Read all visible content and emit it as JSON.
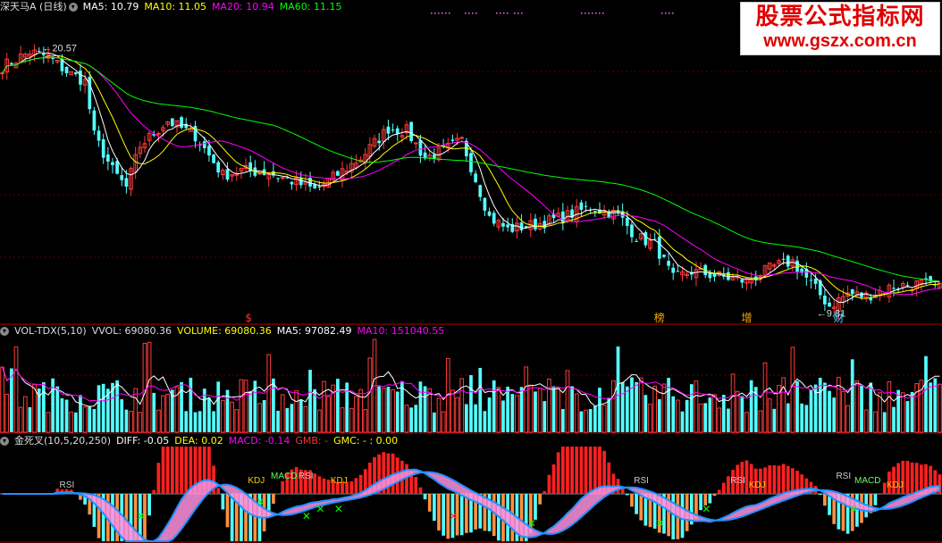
{
  "colors": {
    "up": "#ff3b3b",
    "down": "#54ffff",
    "ma5": "#ffffff",
    "ma10": "#ffff00",
    "ma20": "#ff00ff",
    "ma60": "#00ff00",
    "axis_line": "#b00000",
    "grid": "#5a0000",
    "macd_pos": "#ff2020",
    "macd_neg": "#ff9040",
    "band_blue": "#2090ff",
    "band_pink": "#ff90e0",
    "cross_x": "#00ff00",
    "cross_x_red": "#ff3030"
  },
  "main_header": {
    "title": "深天马A (日线)",
    "ma5": "MA5: 10.79",
    "ma10": "MA10: 11.05",
    "ma20": "MA20: 10.94",
    "ma60": "MA60: 11.15"
  },
  "vol_header": {
    "title": "VOL-TDX(5,10)",
    "vvol": "VVOL: 69080.36",
    "volume": "VOLUME: 69080.36",
    "ma5": "MA5: 97082.49",
    "ma10": "MA10: 151040.55"
  },
  "macd_header": {
    "title": "金死叉(10,5,20,250)",
    "diff": "DIFF: -0.05",
    "dea": "DEA: 0.02",
    "macd": "MACD: -0.14",
    "gmb": "GMB: -",
    "gmc": "GMC: -  : 0.00"
  },
  "watermark": {
    "line1": "股票公式指标网",
    "line2": "www.gszx.com.cn"
  },
  "chart_data": [
    {
      "type": "candlestick",
      "title": "深天马A (日线)",
      "annotations": [
        {
          "text": "20.57",
          "kind": "high",
          "value": 20.57
        },
        {
          "text": "9.81",
          "kind": "low",
          "value": 9.81
        }
      ],
      "event_markers": [
        "$",
        "榜",
        "增",
        "财"
      ],
      "x_count": 205,
      "ylim": [
        9.4,
        22.0
      ],
      "close_anchors": [
        [
          0,
          19.8
        ],
        [
          6,
          20.4
        ],
        [
          10,
          20.2
        ],
        [
          14,
          19.6
        ],
        [
          18,
          19.2
        ],
        [
          20,
          17.0
        ],
        [
          24,
          15.6
        ],
        [
          27,
          14.9
        ],
        [
          30,
          16.6
        ],
        [
          36,
          17.6
        ],
        [
          42,
          17.0
        ],
        [
          48,
          15.4
        ],
        [
          52,
          15.6
        ],
        [
          58,
          15.5
        ],
        [
          64,
          15.1
        ],
        [
          68,
          14.8
        ],
        [
          72,
          15.3
        ],
        [
          78,
          16.1
        ],
        [
          84,
          17.3
        ],
        [
          88,
          17.2
        ],
        [
          92,
          16.1
        ],
        [
          96,
          16.4
        ],
        [
          100,
          16.8
        ],
        [
          106,
          13.7
        ],
        [
          110,
          13.2
        ],
        [
          116,
          13.4
        ],
        [
          122,
          13.7
        ],
        [
          128,
          14.1
        ],
        [
          134,
          13.8
        ],
        [
          138,
          12.9
        ],
        [
          142,
          12.6
        ],
        [
          146,
          11.2
        ],
        [
          150,
          11.5
        ],
        [
          156,
          11.3
        ],
        [
          162,
          11.1
        ],
        [
          168,
          11.7
        ],
        [
          172,
          11.9
        ],
        [
          176,
          11.0
        ],
        [
          180,
          10.1
        ],
        [
          184,
          10.6
        ],
        [
          188,
          10.5
        ],
        [
          194,
          10.9
        ],
        [
          200,
          11.0
        ],
        [
          204,
          10.8
        ]
      ],
      "series": [
        {
          "name": "MA5",
          "value": 10.79
        },
        {
          "name": "MA10",
          "value": 11.05
        },
        {
          "name": "MA20",
          "value": 10.94
        },
        {
          "name": "MA60",
          "value": 11.15
        }
      ]
    },
    {
      "type": "bar",
      "title": "VOL-TDX(5,10)",
      "x_count": 205,
      "ylim": [
        0,
        240000
      ],
      "series": [
        {
          "name": "VOLUME",
          "value": 69080.36
        },
        {
          "name": "MA5",
          "value": 97082.49
        },
        {
          "name": "MA10",
          "value": 151040.55
        }
      ]
    },
    {
      "type": "bar",
      "title": "金死叉(10,5,20,250)",
      "x_count": 205,
      "ylim": [
        -0.9,
        0.9
      ],
      "labels": [
        {
          "text": "RSI",
          "i": 14
        },
        {
          "text": "KDJ",
          "i": 55
        },
        {
          "text": "MACD",
          "i": 60
        },
        {
          "text": "RSI",
          "i": 66
        },
        {
          "text": "KDJ",
          "i": 73
        },
        {
          "text": "RSI",
          "i": 139
        },
        {
          "text": "RSI",
          "i": 160
        },
        {
          "text": "KDJ",
          "i": 164
        },
        {
          "text": "RSI",
          "i": 183
        },
        {
          "text": "MACD",
          "i": 187
        },
        {
          "text": "KDJ",
          "i": 194
        }
      ],
      "crosses": [
        {
          "i": 30,
          "color": "green"
        },
        {
          "i": 56,
          "color": "green"
        },
        {
          "i": 66,
          "color": "green"
        },
        {
          "i": 69,
          "color": "green"
        },
        {
          "i": 73,
          "color": "green"
        },
        {
          "i": 98,
          "color": "red"
        },
        {
          "i": 115,
          "color": "green"
        },
        {
          "i": 143,
          "color": "green"
        },
        {
          "i": 153,
          "color": "green"
        },
        {
          "i": 185,
          "color": "green"
        }
      ],
      "series": [
        {
          "name": "DIFF",
          "value": -0.05
        },
        {
          "name": "DEA",
          "value": 0.02
        },
        {
          "name": "MACD",
          "value": -0.14
        }
      ]
    }
  ]
}
